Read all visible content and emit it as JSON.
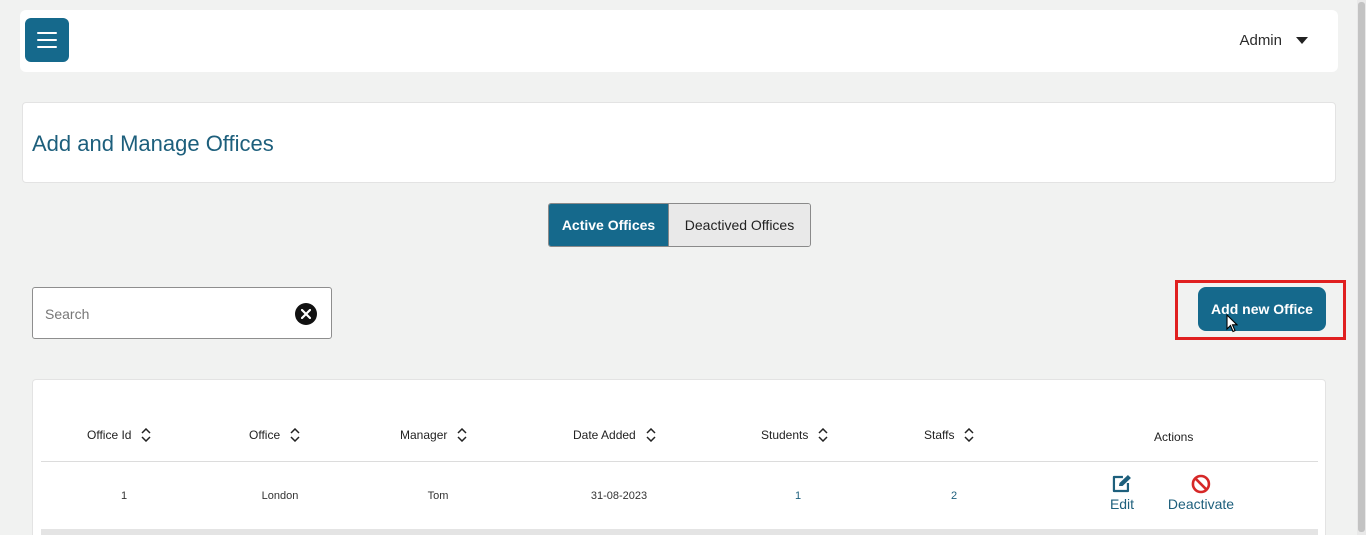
{
  "header": {
    "menu_icon": "hamburger-icon",
    "user_label": "Admin",
    "user_caret_icon": "caret-down-icon"
  },
  "page": {
    "title": "Add and Manage Offices"
  },
  "tabs": {
    "active_label": "Active Offices",
    "inactive_label": "Deactived Offices"
  },
  "search": {
    "placeholder": "Search",
    "value": "",
    "clear_icon": "clear-x-icon"
  },
  "add_button": {
    "label": "Add new Office"
  },
  "table": {
    "columns": [
      "Office Id",
      "Office",
      "Manager",
      "Date Added",
      "Students",
      "Staffs",
      "Actions"
    ],
    "rows": [
      {
        "office_id": "1",
        "office": "London",
        "manager": "Tom",
        "date_added": "31-08-2023",
        "students": "1",
        "staffs": "2",
        "edit_label": "Edit",
        "deactivate_label": "Deactivate"
      }
    ]
  },
  "colors": {
    "primary": "#15698c",
    "title": "#1d5f7c",
    "deactivate": "#d62828",
    "highlight": "#e02020",
    "background": "#f1f2f1"
  }
}
